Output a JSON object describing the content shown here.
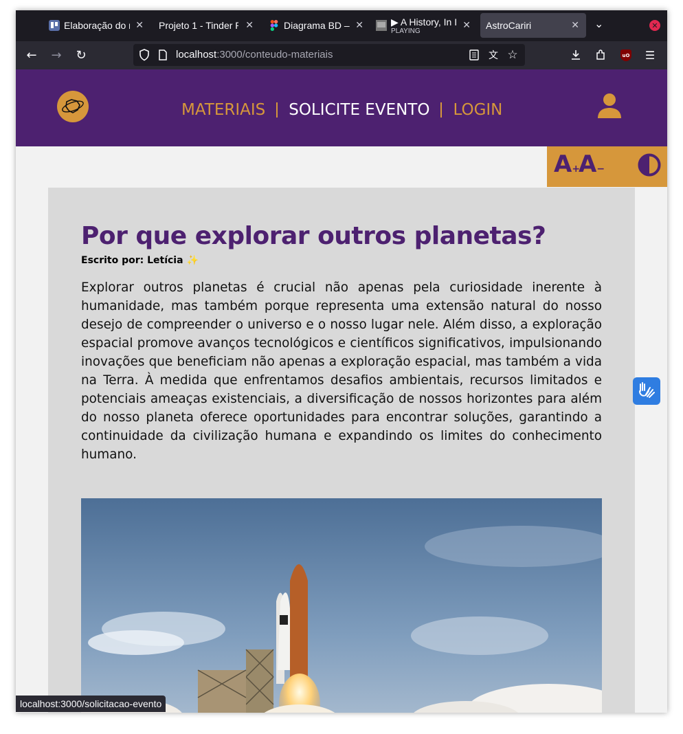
{
  "browser": {
    "tabs": [
      {
        "title": "Elaboração do r",
        "icon": "trello-icon"
      },
      {
        "title": "Projeto 1 - Tinder P",
        "icon": "document-icon"
      },
      {
        "title": "Diagrama BD –",
        "icon": "figma-icon"
      },
      {
        "title": "▶ A History, In I",
        "subtitle": "PLAYING",
        "icon": "video-thumbnail-icon"
      },
      {
        "title": "AstroCariri",
        "icon": "none",
        "active": true
      }
    ],
    "url_host": "localhost",
    "url_path": ":3000/conteudo-materiais",
    "status_url": "localhost:3000/solicitacao-evento"
  },
  "site": {
    "nav": [
      {
        "label": "MATERIAIS",
        "color": "#d6973b"
      },
      {
        "label": "SOLICITE EVENTO",
        "color": "#ffffff"
      },
      {
        "label": "LOGIN",
        "color": "#d6973b"
      }
    ],
    "colors": {
      "brand_purple": "#4d2170",
      "brand_gold": "#d6973b",
      "card_bg": "#d9d9d9",
      "page_bg": "#f2f2f2"
    },
    "a11y": {
      "font_increase": "A",
      "font_decrease": "A",
      "plus": "+",
      "minus": "−"
    }
  },
  "article": {
    "title": "Por que explorar outros planetas?",
    "author_label": "Escrito por: Letícia",
    "author_emoji": "✨",
    "body": "Explorar outros planetas é crucial não apenas pela curiosidade inerente à humanidade, mas também porque representa uma extensão natural do nosso desejo de compreender o universo e o nosso lugar nele. Além disso, a exploração espacial promove avanços tecnológicos e científicos significativos, impulsionando inovações que beneficiam não apenas a exploração espacial, mas também a vida na Terra. À medida que enfrentamos desafios ambientais, recursos limitados e potenciais ameaças existenciais, a diversificação de nossos horizontes para além do nosso planeta oferece oportunidades para encontrar soluções, garantindo a continuidade da civilização humana e expandindo os limites do conhecimento humano."
  }
}
